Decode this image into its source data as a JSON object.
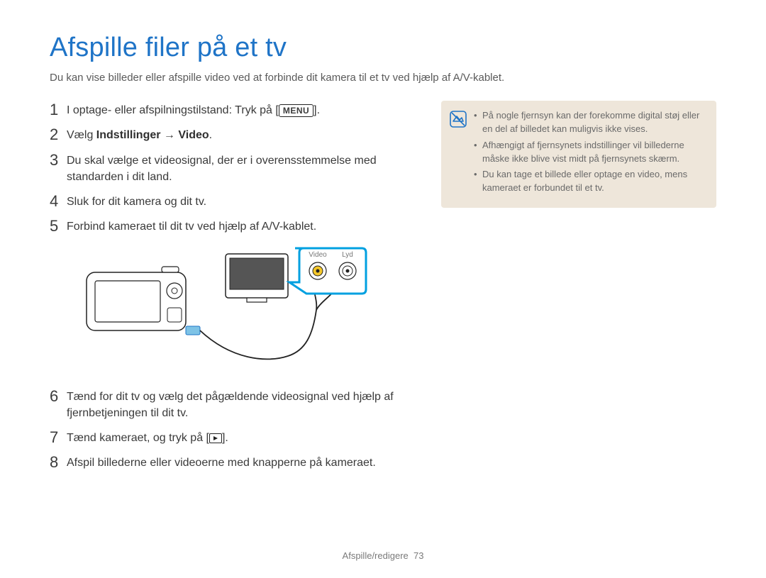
{
  "title": "Afspille filer på et tv",
  "intro": "Du kan vise billeder eller afspille video ved at forbinde dit kamera til et tv ved hjælp af A/V-kablet.",
  "steps": {
    "s1_a": "I optage- eller afspilningstilstand: Tryk på [",
    "s1_menu": "MENU",
    "s1_b": "].",
    "s2_a": "Vælg ",
    "s2_b": "Indstillinger",
    "s2_c": " → ",
    "s2_d": "Video",
    "s2_e": ".",
    "s3": "Du skal vælge et videosignal, der er i overensstemmelse med standarden i dit land.",
    "s4": "Sluk for dit kamera og dit tv.",
    "s5": "Forbind kameraet til dit tv ved hjælp af A/V-kablet.",
    "s6": "Tænd for dit tv og vælg det pågældende videosignal ved hjælp af fjernbetjeningen til dit tv.",
    "s7_a": "Tænd kameraet, og tryk på [",
    "s7_b": "].",
    "s8": "Afspil billederne eller videoerne med knapperne på kameraet."
  },
  "nums": {
    "n1": "1",
    "n2": "2",
    "n3": "3",
    "n4": "4",
    "n5": "5",
    "n6": "6",
    "n7": "7",
    "n8": "8"
  },
  "diagram": {
    "video_label": "Video",
    "audio_label": "Lyd"
  },
  "notes": {
    "n1": "På nogle fjernsyn kan der forekomme digital støj eller en del af billedet kan muligvis ikke vises.",
    "n2": "Afhængigt af fjernsynets indstillinger vil billederne måske ikke blive vist midt på fjernsynets skærm.",
    "n3": "Du kan tage et billede eller optage en video, mens kameraet er forbundet til et tv."
  },
  "footer": {
    "section": "Afspille/redigere",
    "page": "73"
  }
}
